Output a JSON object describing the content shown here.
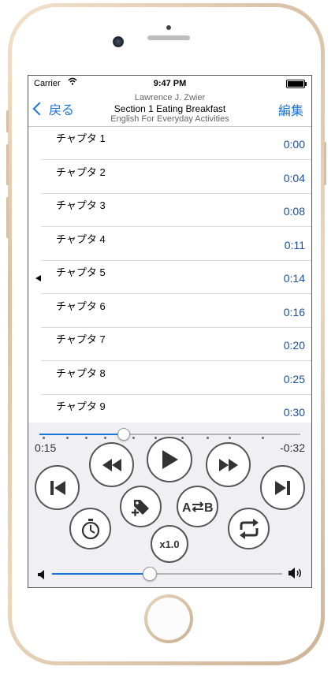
{
  "status_bar": {
    "carrier": "Carrier",
    "time": "9:47 PM"
  },
  "nav": {
    "back_label": "戻る",
    "edit_label": "編集",
    "author": "Lawrence J. Zwier",
    "section": "Section 1 Eating Breakfast",
    "book": "English For Everyday Activities"
  },
  "chapters": [
    {
      "name": "チャプタ 1",
      "time": "0:00",
      "current": false
    },
    {
      "name": "チャプタ 2",
      "time": "0:04",
      "current": false
    },
    {
      "name": "チャプタ 3",
      "time": "0:08",
      "current": false
    },
    {
      "name": "チャプタ 4",
      "time": "0:11",
      "current": false
    },
    {
      "name": "チャプタ 5",
      "time": "0:14",
      "current": true
    },
    {
      "name": "チャプタ 6",
      "time": "0:16",
      "current": false
    },
    {
      "name": "チャプタ 7",
      "time": "0:20",
      "current": false
    },
    {
      "name": "チャプタ 8",
      "time": "0:25",
      "current": false
    },
    {
      "name": "チャプタ 9",
      "time": "0:30",
      "current": false
    }
  ],
  "player": {
    "position": "0:15",
    "remaining": "-0:32",
    "progress_fraction": 0.32,
    "speed_label": "x1.0",
    "volume_fraction": 0.42,
    "accent_color": "#1a73d9"
  },
  "icons": {
    "back": "chevron-left-icon",
    "skip_start": "skip-to-start-icon",
    "rewind": "rewind-icon",
    "play": "play-icon",
    "fast_forward": "fast-forward-icon",
    "skip_end": "skip-to-end-icon",
    "timer": "stopwatch-icon",
    "bookmark": "tag-add-icon",
    "ab_repeat": "ab-repeat-icon",
    "repeat": "repeat-icon",
    "volume_low": "speaker-low-icon",
    "volume_high": "speaker-high-icon"
  }
}
